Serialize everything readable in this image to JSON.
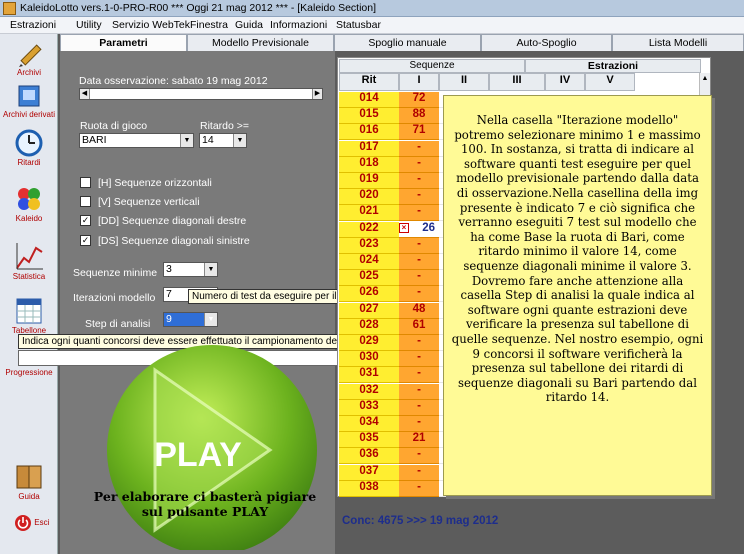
{
  "window": {
    "title": "KaleidoLotto vers.1-0-PRO-R00   ***  Oggi 21 mag 2012  ***   - [Kaleido Section]"
  },
  "menu": [
    "Estrazioni",
    "Utility",
    "Servizio WebTek",
    "Finestra",
    "Guida",
    "Informazioni",
    "Statusbar"
  ],
  "sidebar": {
    "archivi": "Archivi",
    "archivi_derivati": "Archivi derivati",
    "ritardi": "Ritardi",
    "kaleido": "Kaleido",
    "statistica": "Statistica",
    "tabellone": "Tabellone",
    "progressione": "Progressione",
    "guida": "Guida",
    "esci": "Esci"
  },
  "tabs": [
    "Parametri",
    "Modello Previsionale",
    "Spoglio manuale",
    "Auto-Spoglio",
    "Lista Modelli"
  ],
  "params": {
    "data_label": "Data osservazione: sabato 19 mag 2012",
    "ruota_label": "Ruota di gioco",
    "ruota_value": "BARI",
    "ritardo_label": "Ritardo >=",
    "ritardo_value": "14",
    "chk_h": "[H] Sequenze orizzontali",
    "chk_v": "[V] Sequenze verticali",
    "chk_dd": "[DD] Sequenze diagonali destre",
    "chk_ds": "[DS] Sequenze diagonali sinistre",
    "seq_min_label": "Sequenze minime",
    "seq_min_value": "3",
    "iter_label": "Iterazioni modello",
    "iter_value": "7",
    "iter_tooltip": "Numero di test da eseguire per il modello",
    "step_label": "Step di analisi",
    "step_value": "9",
    "step_tooltip": "Indica ogni quanti concorsi deve essere effettuato il campionamento del tabellone"
  },
  "grid": {
    "group_left": "Sequenze",
    "group_right": "Estrazioni",
    "columns": [
      "Rit",
      "I",
      "II",
      "III",
      "IV",
      "V"
    ],
    "rows": [
      {
        "rit": "014",
        "val": "72"
      },
      {
        "rit": "015",
        "val": "88"
      },
      {
        "rit": "016",
        "val": "71"
      },
      {
        "rit": "017",
        "val": "-"
      },
      {
        "rit": "018",
        "val": "-"
      },
      {
        "rit": "019",
        "val": "-"
      },
      {
        "rit": "020",
        "val": "-"
      },
      {
        "rit": "021",
        "val": "-"
      },
      {
        "rit": "022",
        "val": "26"
      },
      {
        "rit": "023",
        "val": "-"
      },
      {
        "rit": "024",
        "val": "-"
      },
      {
        "rit": "025",
        "val": "-"
      },
      {
        "rit": "026",
        "val": "-"
      },
      {
        "rit": "027",
        "val": "48"
      },
      {
        "rit": "028",
        "val": "61"
      },
      {
        "rit": "029",
        "val": "-"
      },
      {
        "rit": "030",
        "val": "-"
      },
      {
        "rit": "031",
        "val": "-"
      },
      {
        "rit": "032",
        "val": "-"
      },
      {
        "rit": "033",
        "val": "-"
      },
      {
        "rit": "034",
        "val": "-"
      },
      {
        "rit": "035",
        "val": "21"
      },
      {
        "rit": "036",
        "val": "-"
      },
      {
        "rit": "037",
        "val": "-"
      },
      {
        "rit": "038",
        "val": "-"
      }
    ]
  },
  "note": "Nella casella \"Iterazione modello\" potremo selezionare minimo 1 e massimo 100. In sostanza, si tratta di indicare al software quanti test eseguire per quel modello previsionale partendo dalla data di osservazione.Nella casellina della img presente è indicato 7 e ciò significa che verranno eseguiti 7 test sul modello che ha come Base la ruota di Bari, come ritardo minimo il valore 14, come sequenze diagonali minime il valore 3. Dovremo fare anche attenzione alla casella Step di analisi la quale indica al software ogni quante estrazioni deve verificare la presenza sul tabellone di quelle sequenze. Nel nostro esempio, ogni 9 concorsi il software verificherà la presenza sul tabellone dei ritardi di sequenze diagonali su Bari partendo dal ritardo 14.",
  "play": {
    "label": "PLAY",
    "caption": "Per elaborare ci basterà pigiare sul pulsante PLAY"
  },
  "status": {
    "conc": "Conc: 4675 >>> 19 mag 2012"
  }
}
